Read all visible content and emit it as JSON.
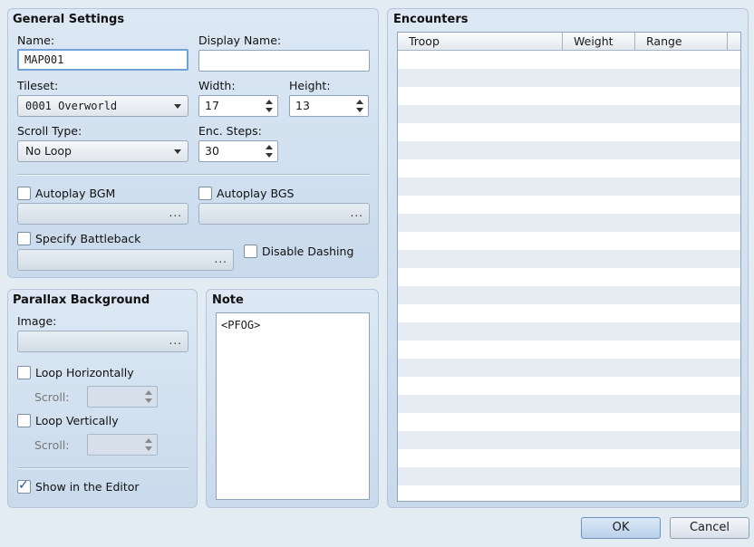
{
  "general": {
    "title": "General Settings",
    "name_label": "Name:",
    "name_value": "MAP001",
    "display_name_label": "Display Name:",
    "display_name_value": "",
    "tileset_label": "Tileset:",
    "tileset_value": "0001 Overworld",
    "width_label": "Width:",
    "width_value": "17",
    "height_label": "Height:",
    "height_value": "13",
    "scroll_type_label": "Scroll Type:",
    "scroll_type_value": "No Loop",
    "enc_steps_label": "Enc. Steps:",
    "enc_steps_value": "30",
    "autoplay_bgm_label": "Autoplay BGM",
    "autoplay_bgm_checked": false,
    "autoplay_bgs_label": "Autoplay BGS",
    "autoplay_bgs_checked": false,
    "specify_battleback_label": "Specify Battleback",
    "specify_battleback_checked": false,
    "disable_dashing_label": "Disable Dashing",
    "disable_dashing_checked": false,
    "browse_glyph": "..."
  },
  "parallax": {
    "title": "Parallax Background",
    "image_label": "Image:",
    "loop_h_label": "Loop Horizontally",
    "loop_h_checked": false,
    "scroll_label": "Scroll:",
    "loop_v_label": "Loop Vertically",
    "loop_v_checked": false,
    "show_editor_label": "Show in the Editor",
    "show_editor_checked": true,
    "check_glyph": "✓"
  },
  "note": {
    "title": "Note",
    "text": "<PFOG>"
  },
  "encounters": {
    "title": "Encounters",
    "columns": [
      "Troop",
      "Weight",
      "Range"
    ],
    "rows": []
  },
  "footer": {
    "ok_label": "OK",
    "cancel_label": "Cancel"
  }
}
